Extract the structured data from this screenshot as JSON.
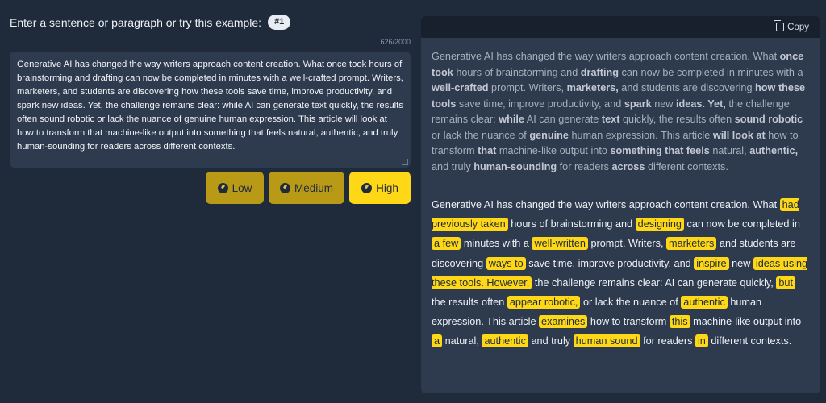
{
  "input": {
    "prompt_label": "Enter a sentence or paragraph or try this example:",
    "example_badge": "#1",
    "char_count": "626/2000",
    "text": "Generative AI has changed the way writers approach content creation. What once took hours of brainstorming and drafting can now be completed in minutes with a well-crafted prompt. Writers, marketers, and students are discovering how these tools save time, improve productivity, and spark new ideas. Yet, the challenge remains clear: while AI can generate text quickly, the results often sound robotic or lack the nuance of genuine human expression. This article will look at how to transform that machine-like output into something that feels natural, authentic, and truly human-sounding for readers across different contexts."
  },
  "buttons": {
    "low": "Low",
    "medium": "Medium",
    "high": "High"
  },
  "output": {
    "copy_label": "Copy",
    "original_segments": [
      {
        "t": "Generative AI has changed the way writers approach content creation. What ",
        "b": false
      },
      {
        "t": "once took",
        "b": true
      },
      {
        "t": " hours of brainstorming and ",
        "b": false
      },
      {
        "t": "drafting",
        "b": true
      },
      {
        "t": " can now be completed in minutes with a ",
        "b": false
      },
      {
        "t": "well-crafted",
        "b": true
      },
      {
        "t": " prompt. Writers, ",
        "b": false
      },
      {
        "t": "marketers,",
        "b": true
      },
      {
        "t": " and students are discovering ",
        "b": false
      },
      {
        "t": "how these tools",
        "b": true
      },
      {
        "t": " save time, improve productivity, and ",
        "b": false
      },
      {
        "t": "spark",
        "b": true
      },
      {
        "t": " new ",
        "b": false
      },
      {
        "t": "ideas. Yet,",
        "b": true
      },
      {
        "t": " the challenge remains clear: ",
        "b": false
      },
      {
        "t": "while",
        "b": true
      },
      {
        "t": " AI can generate ",
        "b": false
      },
      {
        "t": "text",
        "b": true
      },
      {
        "t": " quickly, the results often ",
        "b": false
      },
      {
        "t": "sound robotic",
        "b": true
      },
      {
        "t": " or lack the nuance of ",
        "b": false
      },
      {
        "t": "genuine",
        "b": true
      },
      {
        "t": " human expression. This article ",
        "b": false
      },
      {
        "t": "will look at",
        "b": true
      },
      {
        "t": " how to transform ",
        "b": false
      },
      {
        "t": "that",
        "b": true
      },
      {
        "t": " machine-like output into ",
        "b": false
      },
      {
        "t": "something that feels",
        "b": true
      },
      {
        "t": " natural, ",
        "b": false
      },
      {
        "t": "authentic,",
        "b": true
      },
      {
        "t": " and truly ",
        "b": false
      },
      {
        "t": "human-sounding",
        "b": true
      },
      {
        "t": " for readers ",
        "b": false
      },
      {
        "t": "across",
        "b": true
      },
      {
        "t": " different contexts.",
        "b": false
      }
    ],
    "rewrite_segments": [
      {
        "t": "Generative AI has changed the way writers approach content creation. What ",
        "h": false
      },
      {
        "t": "had previously taken",
        "h": true
      },
      {
        "t": " hours of brainstorming and ",
        "h": false
      },
      {
        "t": "designing",
        "h": true
      },
      {
        "t": " can now be completed in ",
        "h": false
      },
      {
        "t": "a few",
        "h": true
      },
      {
        "t": " minutes with a ",
        "h": false
      },
      {
        "t": "well-written",
        "h": true
      },
      {
        "t": " prompt. Writers, ",
        "h": false
      },
      {
        "t": "marketers",
        "h": true
      },
      {
        "t": " and students are discovering ",
        "h": false
      },
      {
        "t": "ways to",
        "h": true
      },
      {
        "t": " save time, improve productivity, and ",
        "h": false
      },
      {
        "t": "inspire",
        "h": true
      },
      {
        "t": " new ",
        "h": false
      },
      {
        "t": "ideas using these tools. However,",
        "h": true
      },
      {
        "t": " the challenge remains clear: AI can generate quickly, ",
        "h": false
      },
      {
        "t": "but",
        "h": true
      },
      {
        "t": " the results often ",
        "h": false
      },
      {
        "t": "appear robotic,",
        "h": true
      },
      {
        "t": " or lack the nuance of ",
        "h": false
      },
      {
        "t": "authentic",
        "h": true
      },
      {
        "t": " human expression. This article ",
        "h": false
      },
      {
        "t": "examines",
        "h": true
      },
      {
        "t": " how to transform ",
        "h": false
      },
      {
        "t": "this",
        "h": true
      },
      {
        "t": " machine-like output into ",
        "h": false
      },
      {
        "t": "a",
        "h": true
      },
      {
        "t": " natural, ",
        "h": false
      },
      {
        "t": "authentic",
        "h": true
      },
      {
        "t": " and truly ",
        "h": false
      },
      {
        "t": "human sound",
        "h": true
      },
      {
        "t": " for readers ",
        "h": false
      },
      {
        "t": "in",
        "h": true
      },
      {
        "t": " different contexts.",
        "h": false
      }
    ]
  },
  "colors": {
    "background": "#1f2a3b",
    "panel": "#2e3a4d",
    "accent": "#fed816",
    "accent_dim": "#b99a17"
  }
}
